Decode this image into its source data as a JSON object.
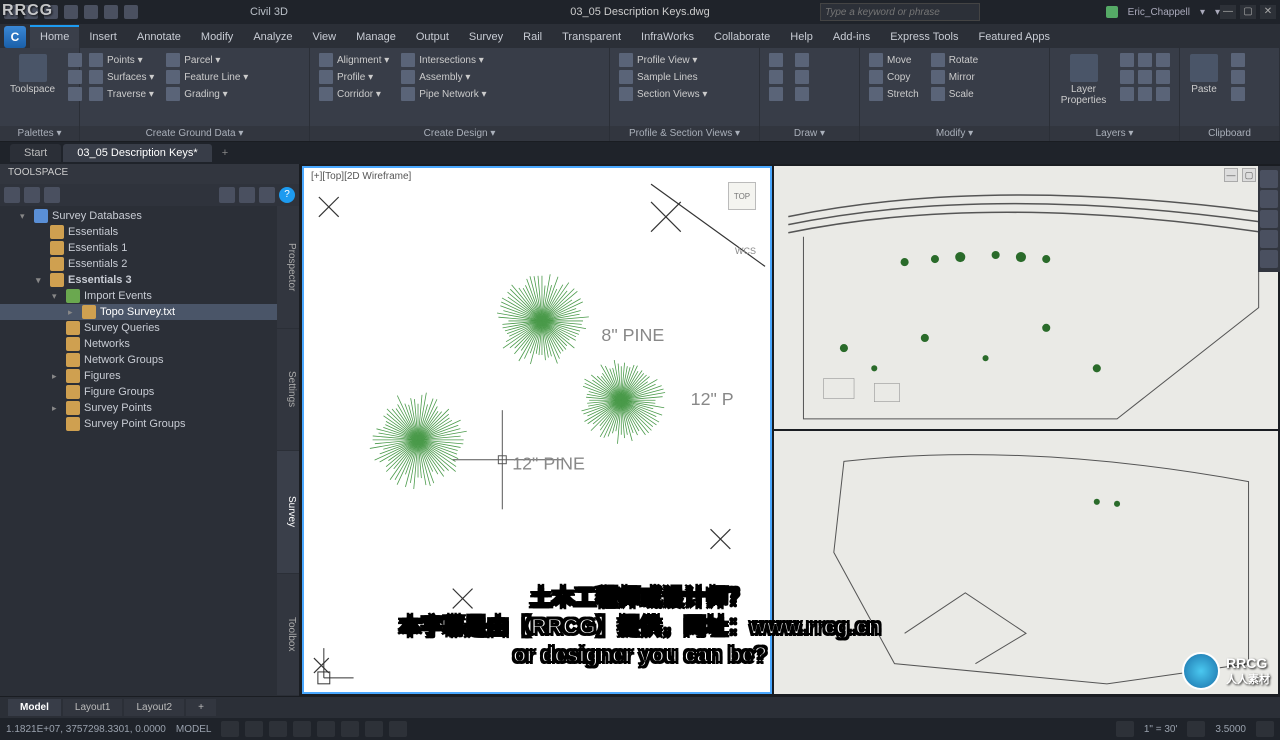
{
  "titlebar": {
    "app_title": "Civil 3D",
    "doc_title": "03_05 Description Keys.dwg",
    "search_placeholder": "Type a keyword or phrase",
    "user_name": "Eric_Chappell",
    "win_min": "—",
    "win_max": "▢",
    "win_close": "✕"
  },
  "app_button": "C",
  "ribbon_tabs": [
    "Home",
    "Insert",
    "Annotate",
    "Modify",
    "Analyze",
    "View",
    "Manage",
    "Output",
    "Survey",
    "Rail",
    "Transparent",
    "InfraWorks",
    "Collaborate",
    "Help",
    "Add-ins",
    "Express Tools",
    "Featured Apps"
  ],
  "ribbon_active_tab": 0,
  "ribbon": {
    "palettes": {
      "label": "Palettes ▾",
      "big": "Toolspace"
    },
    "ground": {
      "label": "Create Ground Data ▾",
      "items": [
        "Points ▾",
        "Surfaces ▾",
        "Traverse ▾",
        "Parcel ▾",
        "Feature Line ▾",
        "Grading ▾"
      ]
    },
    "design": {
      "label": "Create Design ▾",
      "items": [
        "Alignment ▾",
        "Profile ▾",
        "Corridor ▾",
        "Intersections ▾",
        "Assembly ▾",
        "Pipe Network ▾"
      ]
    },
    "profile_section": {
      "label": "Profile & Section Views ▾",
      "items": [
        "Profile View ▾",
        "Sample Lines",
        "Section Views ▾"
      ]
    },
    "draw": {
      "label": "Draw ▾"
    },
    "modify": {
      "label": "Modify ▾",
      "items": [
        "Move",
        "Copy",
        "Stretch",
        "Rotate",
        "Mirror",
        "Scale"
      ]
    },
    "layers": {
      "label": "Layers ▾",
      "big": "Layer Properties"
    },
    "clipboard": {
      "label": "Clipboard",
      "big": "Paste"
    }
  },
  "doctabs": {
    "tabs": [
      "Start",
      "03_05 Description Keys*"
    ],
    "active": 1,
    "plus": "+"
  },
  "toolspace": {
    "title": "TOOLSPACE",
    "help": "?",
    "sidetabs": [
      "Prospector",
      "Settings",
      "Survey",
      "Toolbox"
    ],
    "active_sidetab": 2,
    "tree": [
      {
        "d": 0,
        "exp": "▾",
        "label": "Survey Databases",
        "icon": "db"
      },
      {
        "d": 1,
        "exp": "",
        "label": "Essentials",
        "icon": "g"
      },
      {
        "d": 1,
        "exp": "",
        "label": "Essentials 1",
        "icon": "g"
      },
      {
        "d": 1,
        "exp": "",
        "label": "Essentials 2",
        "icon": "g"
      },
      {
        "d": 1,
        "exp": "▾",
        "label": "Essentials 3",
        "icon": "g",
        "bold": true
      },
      {
        "d": 2,
        "exp": "▾",
        "label": "Import Events",
        "icon": "green"
      },
      {
        "d": 3,
        "exp": "▸",
        "label": "Topo Survey.txt",
        "icon": "g",
        "sel": true
      },
      {
        "d": 2,
        "exp": "",
        "label": "Survey Queries",
        "icon": "g"
      },
      {
        "d": 2,
        "exp": "",
        "label": "Networks",
        "icon": "g"
      },
      {
        "d": 2,
        "exp": "",
        "label": "Network Groups",
        "icon": "g"
      },
      {
        "d": 2,
        "exp": "▸",
        "label": "Figures",
        "icon": "g"
      },
      {
        "d": 2,
        "exp": "",
        "label": "Figure Groups",
        "icon": "g"
      },
      {
        "d": 2,
        "exp": "▸",
        "label": "Survey Points",
        "icon": "g"
      },
      {
        "d": 2,
        "exp": "",
        "label": "Survey Point Groups",
        "icon": "g"
      }
    ]
  },
  "viewport": {
    "left_label": "[+][Top][2D Wireframe]",
    "viewcube": "TOP",
    "wcs": "WCS",
    "labels": {
      "pine8": "8\" PINE",
      "pine12a": "12\" PINE",
      "pine12b": "12\" P"
    }
  },
  "layouttabs": {
    "tabs": [
      "Model",
      "Layout1",
      "Layout2"
    ],
    "active": 0,
    "plus": "+"
  },
  "statusbar": {
    "coords": "1.1821E+07, 3757298.3301, 0.0000",
    "model": "MODEL",
    "scale": "1\" = 30'",
    "decimal": "3.5000"
  },
  "subtitles": {
    "line1": "土木工程师或设计师？",
    "line2": "本字幕是由【RRCG】提供，网址：www.rrcg.cn",
    "line3": "or designer you can be?"
  },
  "corner_logo": {
    "text1": "RRCG",
    "text2": "人人素材"
  },
  "tl_watermark": "RRCG"
}
